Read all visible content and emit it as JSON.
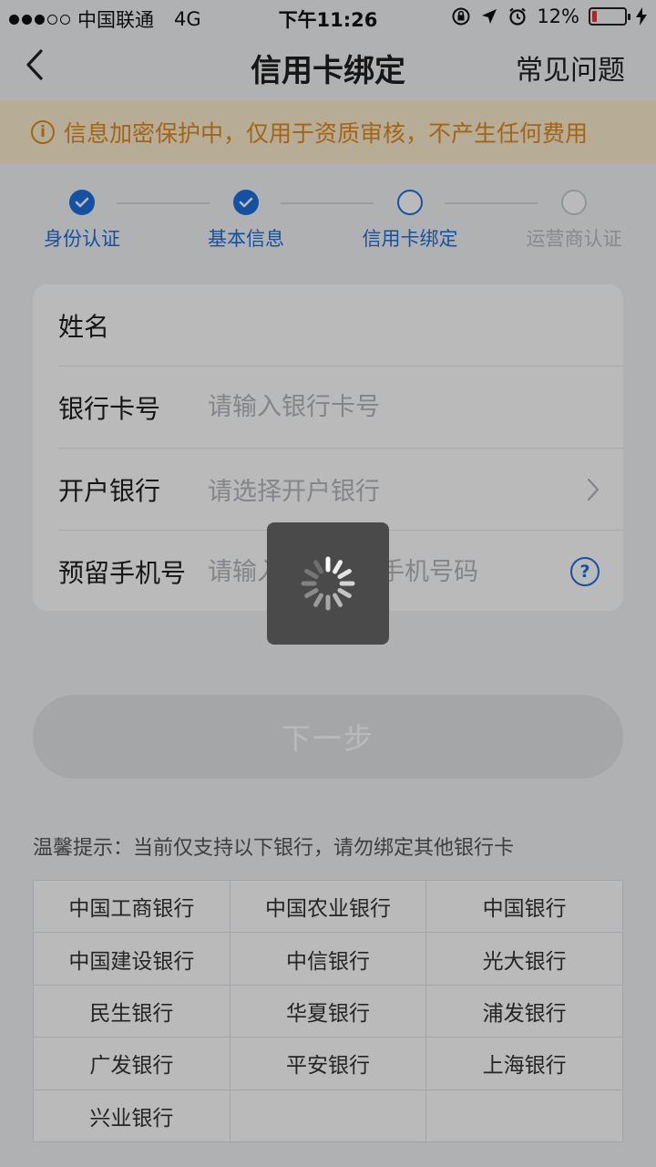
{
  "status_bar": {
    "carrier": "中国联通",
    "network": "4G",
    "time": "下午11:26",
    "battery_percent": "12%",
    "signal_bars_filled": 3,
    "signal_bars_total": 5,
    "battery_level": 0.12,
    "battery_color": "#e5383b"
  },
  "nav": {
    "title": "信用卡绑定",
    "faq_label": "常见问题",
    "back_icon": "chevron-left-icon"
  },
  "notice": {
    "icon": "info-icon",
    "text": "信息加密保护中，仅用于资质审核，不产生任何费用",
    "color": "#e08a1e"
  },
  "steps": [
    {
      "label": "身份认证",
      "state": "done"
    },
    {
      "label": "基本信息",
      "state": "done"
    },
    {
      "label": "信用卡绑定",
      "state": "current"
    },
    {
      "label": "运营商认证",
      "state": "todo"
    }
  ],
  "form": {
    "name_label": "姓名",
    "card_label": "银行卡号",
    "card_placeholder": "请输入银行卡号",
    "bank_label": "开户银行",
    "bank_placeholder": "请选择开户银行",
    "phone_label": "预留手机号",
    "phone_placeholder": "请输入银行预留手机号码"
  },
  "next_button": "下一步",
  "tips": "温馨提示：当前仅支持以下银行，请勿绑定其他银行卡",
  "banks": [
    [
      "中国工商银行",
      "中国农业银行",
      "中国银行"
    ],
    [
      "中国建设银行",
      "中信银行",
      "光大银行"
    ],
    [
      "民生银行",
      "华夏银行",
      "浦发银行"
    ],
    [
      "广发银行",
      "平安银行",
      "上海银行"
    ],
    [
      "兴业银行",
      "",
      ""
    ]
  ],
  "colors": {
    "accent": "#1e6fe0",
    "notice_bg": "#fbeed0"
  },
  "loading": {
    "visible": true,
    "icon": "spinner-icon"
  }
}
